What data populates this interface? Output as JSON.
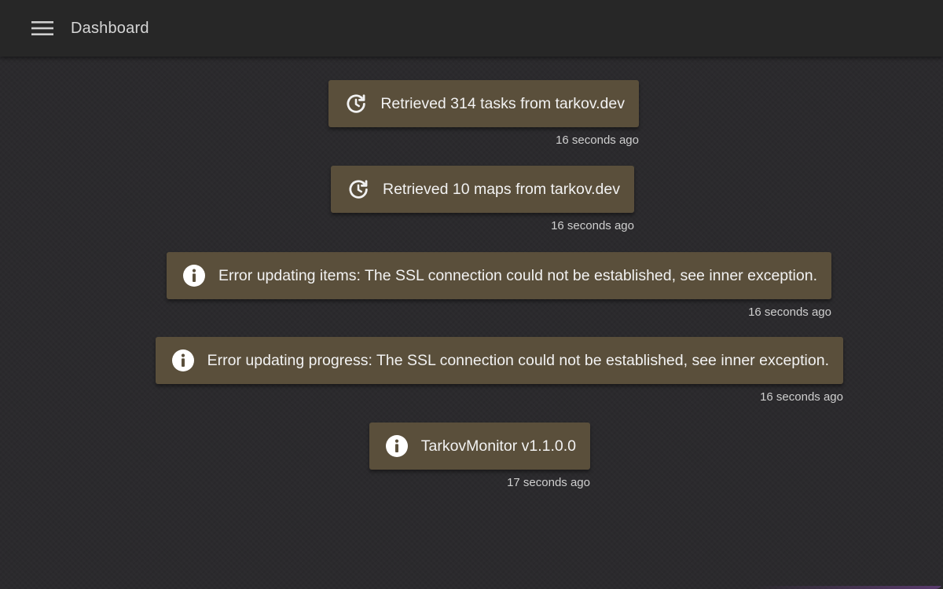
{
  "header": {
    "title": "Dashboard",
    "menu_icon": "hamburger-menu-icon"
  },
  "theme": {
    "background": "#2b2a2d",
    "app_bar": "#272727",
    "bubble": "#5a4f3b",
    "text": "#f2f2f2",
    "timestamp_text": "#cfcfcf"
  },
  "messages": [
    {
      "icon": "refresh-clock-icon",
      "text": "Retrieved 314 tasks from tarkov.dev",
      "time": "16 seconds ago"
    },
    {
      "icon": "refresh-clock-icon",
      "text": "Retrieved 10 maps from tarkov.dev",
      "time": "16 seconds ago"
    },
    {
      "icon": "info-icon",
      "text": "Error updating items: The SSL connection could not be established, see inner exception.",
      "time": "16 seconds ago"
    },
    {
      "icon": "info-icon",
      "text": "Error updating progress: The SSL connection could not be established, see inner exception.",
      "time": "16 seconds ago"
    },
    {
      "icon": "info-icon",
      "text": "TarkovMonitor v1.1.0.0",
      "time": "17 seconds ago"
    }
  ]
}
